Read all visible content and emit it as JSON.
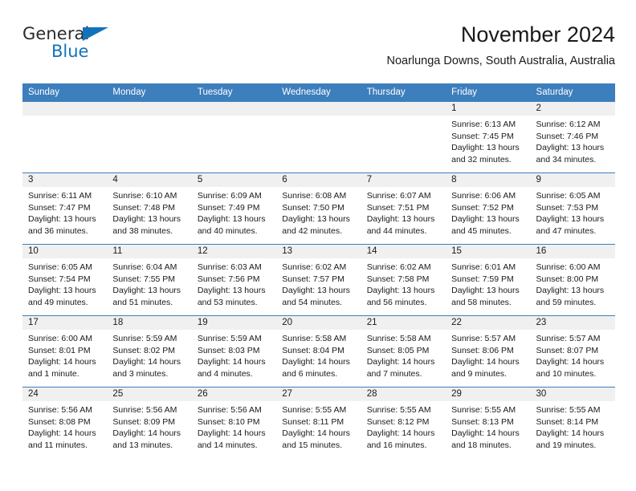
{
  "brand": {
    "name_part1": "General",
    "name_part2": "Blue",
    "triangle_icon": "blue-triangle-icon",
    "accent_color": "#1273ba"
  },
  "header": {
    "title": "November 2024",
    "subtitle": "Noarlunga Downs, South Australia, Australia"
  },
  "theme": {
    "header_row_color": "#3d7ebd",
    "day_band_color": "#f0f0f0",
    "text_color": "#1a1a1a"
  },
  "weekdays": [
    "Sunday",
    "Monday",
    "Tuesday",
    "Wednesday",
    "Thursday",
    "Friday",
    "Saturday"
  ],
  "weeks": [
    [
      {
        "day": "",
        "empty": true,
        "sunrise": "",
        "sunset": "",
        "daylight_line1": "",
        "daylight_line2": ""
      },
      {
        "day": "",
        "empty": true,
        "sunrise": "",
        "sunset": "",
        "daylight_line1": "",
        "daylight_line2": ""
      },
      {
        "day": "",
        "empty": true,
        "sunrise": "",
        "sunset": "",
        "daylight_line1": "",
        "daylight_line2": ""
      },
      {
        "day": "",
        "empty": true,
        "sunrise": "",
        "sunset": "",
        "daylight_line1": "",
        "daylight_line2": ""
      },
      {
        "day": "",
        "empty": true,
        "sunrise": "",
        "sunset": "",
        "daylight_line1": "",
        "daylight_line2": ""
      },
      {
        "day": "1",
        "empty": false,
        "sunrise": "Sunrise: 6:13 AM",
        "sunset": "Sunset: 7:45 PM",
        "daylight_line1": "Daylight: 13 hours",
        "daylight_line2": "and 32 minutes."
      },
      {
        "day": "2",
        "empty": false,
        "sunrise": "Sunrise: 6:12 AM",
        "sunset": "Sunset: 7:46 PM",
        "daylight_line1": "Daylight: 13 hours",
        "daylight_line2": "and 34 minutes."
      }
    ],
    [
      {
        "day": "3",
        "empty": false,
        "sunrise": "Sunrise: 6:11 AM",
        "sunset": "Sunset: 7:47 PM",
        "daylight_line1": "Daylight: 13 hours",
        "daylight_line2": "and 36 minutes."
      },
      {
        "day": "4",
        "empty": false,
        "sunrise": "Sunrise: 6:10 AM",
        "sunset": "Sunset: 7:48 PM",
        "daylight_line1": "Daylight: 13 hours",
        "daylight_line2": "and 38 minutes."
      },
      {
        "day": "5",
        "empty": false,
        "sunrise": "Sunrise: 6:09 AM",
        "sunset": "Sunset: 7:49 PM",
        "daylight_line1": "Daylight: 13 hours",
        "daylight_line2": "and 40 minutes."
      },
      {
        "day": "6",
        "empty": false,
        "sunrise": "Sunrise: 6:08 AM",
        "sunset": "Sunset: 7:50 PM",
        "daylight_line1": "Daylight: 13 hours",
        "daylight_line2": "and 42 minutes."
      },
      {
        "day": "7",
        "empty": false,
        "sunrise": "Sunrise: 6:07 AM",
        "sunset": "Sunset: 7:51 PM",
        "daylight_line1": "Daylight: 13 hours",
        "daylight_line2": "and 44 minutes."
      },
      {
        "day": "8",
        "empty": false,
        "sunrise": "Sunrise: 6:06 AM",
        "sunset": "Sunset: 7:52 PM",
        "daylight_line1": "Daylight: 13 hours",
        "daylight_line2": "and 45 minutes."
      },
      {
        "day": "9",
        "empty": false,
        "sunrise": "Sunrise: 6:05 AM",
        "sunset": "Sunset: 7:53 PM",
        "daylight_line1": "Daylight: 13 hours",
        "daylight_line2": "and 47 minutes."
      }
    ],
    [
      {
        "day": "10",
        "empty": false,
        "sunrise": "Sunrise: 6:05 AM",
        "sunset": "Sunset: 7:54 PM",
        "daylight_line1": "Daylight: 13 hours",
        "daylight_line2": "and 49 minutes."
      },
      {
        "day": "11",
        "empty": false,
        "sunrise": "Sunrise: 6:04 AM",
        "sunset": "Sunset: 7:55 PM",
        "daylight_line1": "Daylight: 13 hours",
        "daylight_line2": "and 51 minutes."
      },
      {
        "day": "12",
        "empty": false,
        "sunrise": "Sunrise: 6:03 AM",
        "sunset": "Sunset: 7:56 PM",
        "daylight_line1": "Daylight: 13 hours",
        "daylight_line2": "and 53 minutes."
      },
      {
        "day": "13",
        "empty": false,
        "sunrise": "Sunrise: 6:02 AM",
        "sunset": "Sunset: 7:57 PM",
        "daylight_line1": "Daylight: 13 hours",
        "daylight_line2": "and 54 minutes."
      },
      {
        "day": "14",
        "empty": false,
        "sunrise": "Sunrise: 6:02 AM",
        "sunset": "Sunset: 7:58 PM",
        "daylight_line1": "Daylight: 13 hours",
        "daylight_line2": "and 56 minutes."
      },
      {
        "day": "15",
        "empty": false,
        "sunrise": "Sunrise: 6:01 AM",
        "sunset": "Sunset: 7:59 PM",
        "daylight_line1": "Daylight: 13 hours",
        "daylight_line2": "and 58 minutes."
      },
      {
        "day": "16",
        "empty": false,
        "sunrise": "Sunrise: 6:00 AM",
        "sunset": "Sunset: 8:00 PM",
        "daylight_line1": "Daylight: 13 hours",
        "daylight_line2": "and 59 minutes."
      }
    ],
    [
      {
        "day": "17",
        "empty": false,
        "sunrise": "Sunrise: 6:00 AM",
        "sunset": "Sunset: 8:01 PM",
        "daylight_line1": "Daylight: 14 hours",
        "daylight_line2": "and 1 minute."
      },
      {
        "day": "18",
        "empty": false,
        "sunrise": "Sunrise: 5:59 AM",
        "sunset": "Sunset: 8:02 PM",
        "daylight_line1": "Daylight: 14 hours",
        "daylight_line2": "and 3 minutes."
      },
      {
        "day": "19",
        "empty": false,
        "sunrise": "Sunrise: 5:59 AM",
        "sunset": "Sunset: 8:03 PM",
        "daylight_line1": "Daylight: 14 hours",
        "daylight_line2": "and 4 minutes."
      },
      {
        "day": "20",
        "empty": false,
        "sunrise": "Sunrise: 5:58 AM",
        "sunset": "Sunset: 8:04 PM",
        "daylight_line1": "Daylight: 14 hours",
        "daylight_line2": "and 6 minutes."
      },
      {
        "day": "21",
        "empty": false,
        "sunrise": "Sunrise: 5:58 AM",
        "sunset": "Sunset: 8:05 PM",
        "daylight_line1": "Daylight: 14 hours",
        "daylight_line2": "and 7 minutes."
      },
      {
        "day": "22",
        "empty": false,
        "sunrise": "Sunrise: 5:57 AM",
        "sunset": "Sunset: 8:06 PM",
        "daylight_line1": "Daylight: 14 hours",
        "daylight_line2": "and 9 minutes."
      },
      {
        "day": "23",
        "empty": false,
        "sunrise": "Sunrise: 5:57 AM",
        "sunset": "Sunset: 8:07 PM",
        "daylight_line1": "Daylight: 14 hours",
        "daylight_line2": "and 10 minutes."
      }
    ],
    [
      {
        "day": "24",
        "empty": false,
        "sunrise": "Sunrise: 5:56 AM",
        "sunset": "Sunset: 8:08 PM",
        "daylight_line1": "Daylight: 14 hours",
        "daylight_line2": "and 11 minutes."
      },
      {
        "day": "25",
        "empty": false,
        "sunrise": "Sunrise: 5:56 AM",
        "sunset": "Sunset: 8:09 PM",
        "daylight_line1": "Daylight: 14 hours",
        "daylight_line2": "and 13 minutes."
      },
      {
        "day": "26",
        "empty": false,
        "sunrise": "Sunrise: 5:56 AM",
        "sunset": "Sunset: 8:10 PM",
        "daylight_line1": "Daylight: 14 hours",
        "daylight_line2": "and 14 minutes."
      },
      {
        "day": "27",
        "empty": false,
        "sunrise": "Sunrise: 5:55 AM",
        "sunset": "Sunset: 8:11 PM",
        "daylight_line1": "Daylight: 14 hours",
        "daylight_line2": "and 15 minutes."
      },
      {
        "day": "28",
        "empty": false,
        "sunrise": "Sunrise: 5:55 AM",
        "sunset": "Sunset: 8:12 PM",
        "daylight_line1": "Daylight: 14 hours",
        "daylight_line2": "and 16 minutes."
      },
      {
        "day": "29",
        "empty": false,
        "sunrise": "Sunrise: 5:55 AM",
        "sunset": "Sunset: 8:13 PM",
        "daylight_line1": "Daylight: 14 hours",
        "daylight_line2": "and 18 minutes."
      },
      {
        "day": "30",
        "empty": false,
        "sunrise": "Sunrise: 5:55 AM",
        "sunset": "Sunset: 8:14 PM",
        "daylight_line1": "Daylight: 14 hours",
        "daylight_line2": "and 19 minutes."
      }
    ]
  ]
}
